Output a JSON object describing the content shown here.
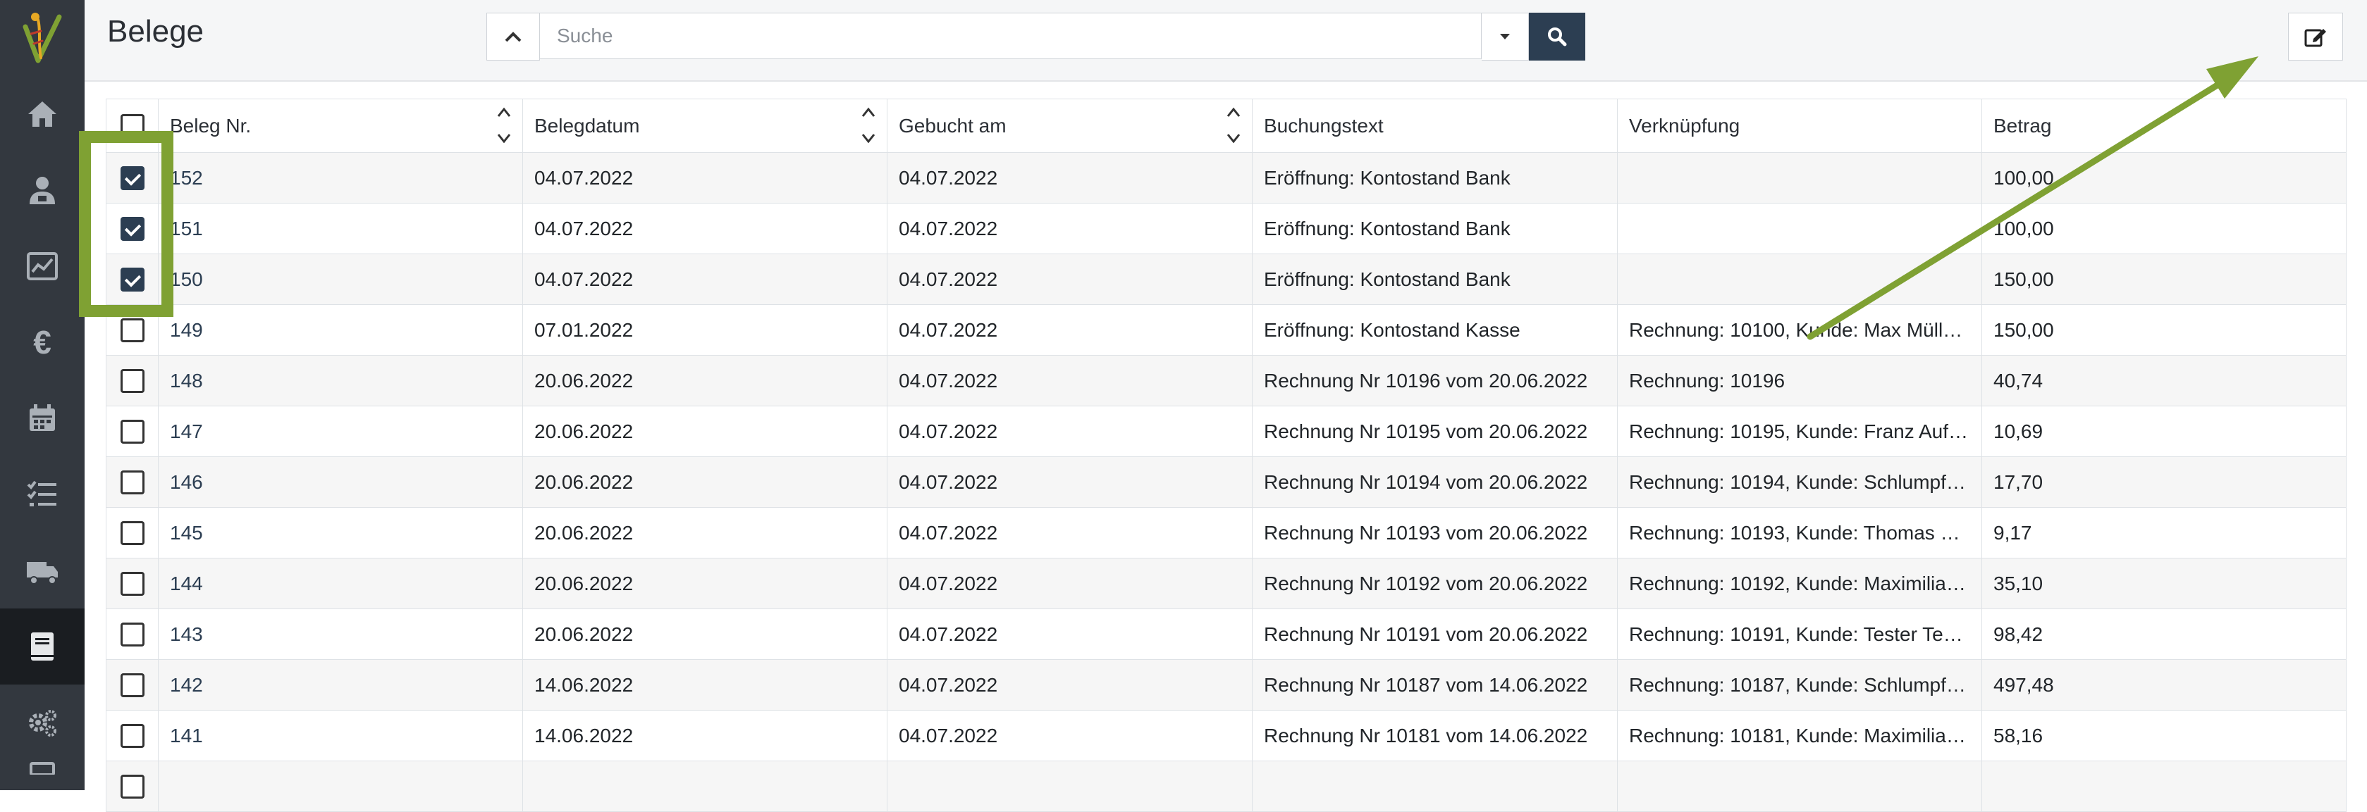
{
  "app": {
    "title": "Belege"
  },
  "search": {
    "placeholder": "Suche"
  },
  "table": {
    "columns": [
      "Beleg Nr.",
      "Belegdatum",
      "Gebucht am",
      "Buchungstext",
      "Verknüpfung",
      "Betrag"
    ],
    "rows": [
      {
        "checked": true,
        "nr": "152",
        "belegdatum": "04.07.2022",
        "gebucht": "04.07.2022",
        "text": "Eröffnung: Kontostand Bank",
        "verknuepfung": "",
        "betrag": "100,00"
      },
      {
        "checked": true,
        "nr": "151",
        "belegdatum": "04.07.2022",
        "gebucht": "04.07.2022",
        "text": "Eröffnung: Kontostand Bank",
        "verknuepfung": "",
        "betrag": "100,00"
      },
      {
        "checked": true,
        "nr": "150",
        "belegdatum": "04.07.2022",
        "gebucht": "04.07.2022",
        "text": "Eröffnung: Kontostand Bank",
        "verknuepfung": "",
        "betrag": "150,00"
      },
      {
        "checked": false,
        "nr": "149",
        "belegdatum": "07.01.2022",
        "gebucht": "04.07.2022",
        "text": "Eröffnung: Kontostand Kasse",
        "verknuepfung": "Rechnung: 10100, Kunde: Max Müller,…",
        "betrag": "150,00"
      },
      {
        "checked": false,
        "nr": "148",
        "belegdatum": "20.06.2022",
        "gebucht": "04.07.2022",
        "text": "Rechnung Nr 10196 vom 20.06.2022",
        "verknuepfung": "Rechnung: 10196",
        "betrag": "40,74"
      },
      {
        "checked": false,
        "nr": "147",
        "belegdatum": "20.06.2022",
        "gebucht": "04.07.2022",
        "text": "Rechnung Nr 10195 vom 20.06.2022",
        "verknuepfung": "Rechnung: 10195, Kunde: Franz Aufh…",
        "betrag": "10,69"
      },
      {
        "checked": false,
        "nr": "146",
        "belegdatum": "20.06.2022",
        "gebucht": "04.07.2022",
        "text": "Rechnung Nr 10194 vom 20.06.2022",
        "verknuepfung": "Rechnung: 10194, Kunde: Schlumpf …",
        "betrag": "17,70"
      },
      {
        "checked": false,
        "nr": "145",
        "belegdatum": "20.06.2022",
        "gebucht": "04.07.2022",
        "text": "Rechnung Nr 10193 vom 20.06.2022",
        "verknuepfung": "Rechnung: 10193, Kunde: Thomas Sc…",
        "betrag": "9,17"
      },
      {
        "checked": false,
        "nr": "144",
        "belegdatum": "20.06.2022",
        "gebucht": "04.07.2022",
        "text": "Rechnung Nr 10192 vom 20.06.2022",
        "verknuepfung": "Rechnung: 10192, Kunde: Maximilian…",
        "betrag": "35,10"
      },
      {
        "checked": false,
        "nr": "143",
        "belegdatum": "20.06.2022",
        "gebucht": "04.07.2022",
        "text": "Rechnung Nr 10191 vom 20.06.2022",
        "verknuepfung": "Rechnung: 10191, Kunde: Tester Test…",
        "betrag": "98,42"
      },
      {
        "checked": false,
        "nr": "142",
        "belegdatum": "14.06.2022",
        "gebucht": "04.07.2022",
        "text": "Rechnung Nr 10187 vom 14.06.2022",
        "verknuepfung": "Rechnung: 10187, Kunde: Schlumpf …",
        "betrag": "497,48"
      },
      {
        "checked": false,
        "nr": "141",
        "belegdatum": "14.06.2022",
        "gebucht": "04.07.2022",
        "text": "Rechnung Nr 10181 vom 14.06.2022",
        "verknuepfung": "Rechnung: 10181, Kunde: Maximilian…",
        "betrag": "58,16"
      },
      {
        "checked": false,
        "nr": "",
        "belegdatum": "",
        "gebucht": "",
        "text": "",
        "verknuepfung": "",
        "betrag": ""
      }
    ]
  },
  "sidebar": {
    "items": [
      {
        "icon": "home-icon"
      },
      {
        "icon": "users-icon"
      },
      {
        "icon": "chart-icon"
      },
      {
        "icon": "euro-icon",
        "glyph": "€"
      },
      {
        "icon": "calendar-icon"
      },
      {
        "icon": "tasks-icon"
      },
      {
        "icon": "truck-icon"
      },
      {
        "icon": "book-icon"
      },
      {
        "icon": "gears-icon"
      }
    ]
  },
  "colors": {
    "sidebar": "#33383f",
    "sidebar_active": "#1a1d21",
    "accent": "#2c3e52",
    "highlight": "#7fa133"
  }
}
